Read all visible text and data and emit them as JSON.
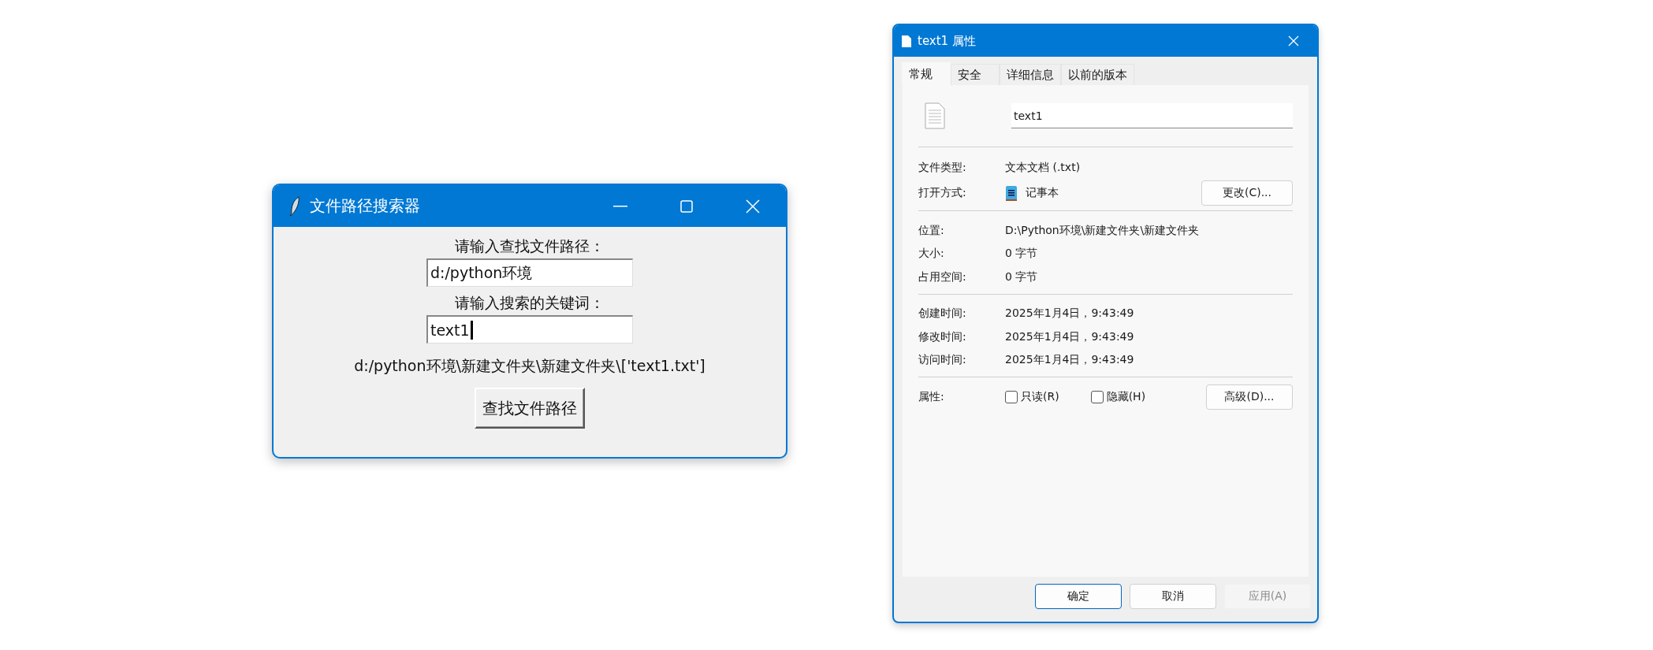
{
  "search_window": {
    "title": "文件路径搜索器",
    "path_label": "请输入查找文件路径：",
    "path_value": "d:/python环境",
    "keyword_label": "请输入搜索的关键词：",
    "keyword_value": "text1",
    "result": "d:/python环境\\新建文件夹\\新建文件夹\\['text1.txt']",
    "search_button": "查找文件路径"
  },
  "properties_dialog": {
    "title": "text1 属性",
    "tabs": [
      {
        "label": "常规",
        "selected": true
      },
      {
        "label": "安全",
        "selected": false
      },
      {
        "label": "详细信息",
        "selected": false
      },
      {
        "label": "以前的版本",
        "selected": false
      }
    ],
    "file_name": "text1",
    "sections": [
      [
        {
          "label": "文件类型:",
          "value": "文本文档 (.txt)"
        },
        {
          "label": "打开方式:",
          "value": "记事本",
          "app_icon": true,
          "button": "更改(C)..."
        }
      ],
      [
        {
          "label": "位置:",
          "value": "D:\\Python环境\\新建文件夹\\新建文件夹"
        },
        {
          "label": "大小:",
          "value": "0 字节"
        },
        {
          "label": "占用空间:",
          "value": "0 字节"
        }
      ],
      [
        {
          "label": "创建时间:",
          "value": "2025年1月4日，9:43:49"
        },
        {
          "label": "修改时间:",
          "value": "2025年1月4日，9:43:49"
        },
        {
          "label": "访问时间:",
          "value": "2025年1月4日，9:43:49"
        }
      ]
    ],
    "attributes_label": "属性:",
    "attributes": [
      {
        "label": "只读(R)",
        "checked": false
      },
      {
        "label": "隐藏(H)",
        "checked": false
      }
    ],
    "advanced_button": "高级(D)...",
    "buttons": [
      {
        "label": "确定",
        "disabled": false,
        "default": true
      },
      {
        "label": "取消",
        "disabled": false,
        "default": false
      },
      {
        "label": "应用(A)",
        "disabled": true,
        "default": false
      }
    ]
  }
}
